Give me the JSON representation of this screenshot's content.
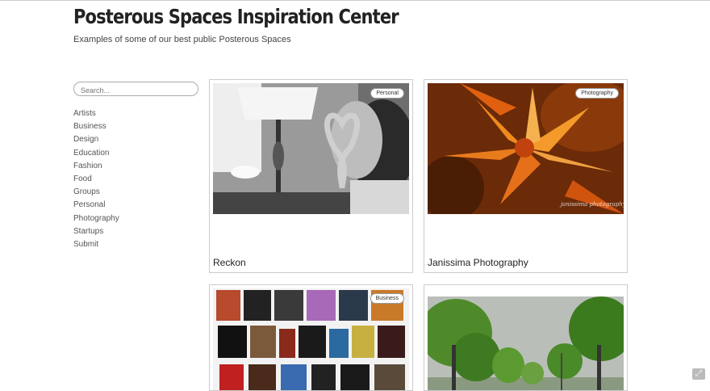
{
  "header": {
    "title": "Posterous Spaces Inspiration Center",
    "subtitle": "Examples of some of our best public Posterous Spaces"
  },
  "search": {
    "placeholder": "Search..."
  },
  "categories": [
    "Artists",
    "Business",
    "Design",
    "Education",
    "Fashion",
    "Food",
    "Groups",
    "Personal",
    "Photography",
    "Startups",
    "Submit"
  ],
  "cards": [
    {
      "title": "Reckon",
      "badge": "Personal"
    },
    {
      "title": "Janissima Photography",
      "badge": "Photography",
      "watermark": "janissima photography"
    },
    {
      "title": "",
      "badge": "Business"
    },
    {
      "title": "",
      "badge": ""
    }
  ]
}
